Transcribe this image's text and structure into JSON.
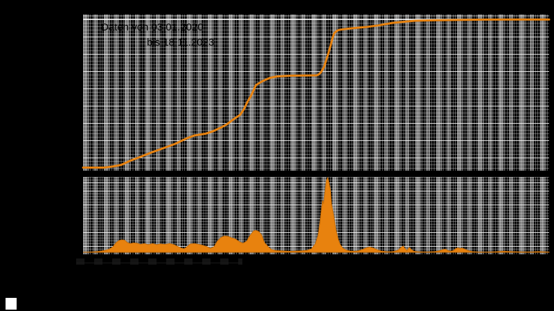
{
  "annotation": {
    "line1": "Daten von 03.01.2020",
    "line2": "bis 18.11.2023"
  },
  "colors": {
    "accent_orange": "#e8820e",
    "accent_orange_dark": "#c96e06",
    "plot_background": "#000000",
    "grid_bright": "#ffffff",
    "grid_gray": "#a5a5a5",
    "annotation_text": "#000000",
    "marker_square": "#ffffff"
  },
  "chart_data": [
    {
      "type": "line",
      "name": "cumulative-total",
      "title": "",
      "x_range": [
        "03.01.2020",
        "18.11.2023"
      ],
      "xlabel": "",
      "ylabel": "",
      "y_normalized": true,
      "ylim": [
        0,
        1
      ],
      "grid": true,
      "legend": "none",
      "annotations": [
        "Daten von 03.01.2020",
        "bis 18.11.2023"
      ],
      "points": [
        [
          0.0,
          0.034
        ],
        [
          0.045,
          0.034
        ],
        [
          0.064,
          0.041
        ],
        [
          0.082,
          0.052
        ],
        [
          0.1,
          0.077
        ],
        [
          0.119,
          0.099
        ],
        [
          0.149,
          0.135
        ],
        [
          0.174,
          0.162
        ],
        [
          0.198,
          0.189
        ],
        [
          0.22,
          0.221
        ],
        [
          0.238,
          0.243
        ],
        [
          0.263,
          0.255
        ],
        [
          0.278,
          0.27
        ],
        [
          0.297,
          0.297
        ],
        [
          0.308,
          0.315
        ],
        [
          0.322,
          0.347
        ],
        [
          0.337,
          0.378
        ],
        [
          0.345,
          0.414
        ],
        [
          0.352,
          0.459
        ],
        [
          0.36,
          0.5
        ],
        [
          0.371,
          0.572
        ],
        [
          0.386,
          0.599
        ],
        [
          0.401,
          0.619
        ],
        [
          0.416,
          0.628
        ],
        [
          0.446,
          0.633
        ],
        [
          0.476,
          0.634
        ],
        [
          0.501,
          0.635
        ],
        [
          0.505,
          0.64
        ],
        [
          0.51,
          0.653
        ],
        [
          0.517,
          0.689
        ],
        [
          0.525,
          0.766
        ],
        [
          0.531,
          0.829
        ],
        [
          0.535,
          0.878
        ],
        [
          0.539,
          0.91
        ],
        [
          0.545,
          0.926
        ],
        [
          0.55,
          0.932
        ],
        [
          0.565,
          0.938
        ],
        [
          0.587,
          0.945
        ],
        [
          0.605,
          0.949
        ],
        [
          0.634,
          0.961
        ],
        [
          0.664,
          0.977
        ],
        [
          0.694,
          0.986
        ],
        [
          0.713,
          0.991
        ],
        [
          0.758,
          0.994
        ],
        [
          0.802,
          0.996
        ],
        [
          0.862,
          0.998
        ],
        [
          0.936,
          0.999
        ],
        [
          1.0,
          0.999
        ]
      ]
    },
    {
      "type": "area",
      "name": "daily-values",
      "title": "",
      "x_range": [
        "03.01.2020",
        "18.11.2023"
      ],
      "xlabel": "",
      "ylabel": "",
      "y_normalized": true,
      "ylim": [
        0,
        1
      ],
      "grid": true,
      "legend": "none",
      "points": [
        [
          0.0,
          0.0
        ],
        [
          0.012,
          0.003
        ],
        [
          0.024,
          0.007
        ],
        [
          0.037,
          0.014
        ],
        [
          0.049,
          0.028
        ],
        [
          0.056,
          0.042
        ],
        [
          0.064,
          0.074
        ],
        [
          0.071,
          0.13
        ],
        [
          0.077,
          0.157
        ],
        [
          0.083,
          0.167
        ],
        [
          0.089,
          0.162
        ],
        [
          0.095,
          0.13
        ],
        [
          0.101,
          0.116
        ],
        [
          0.108,
          0.125
        ],
        [
          0.116,
          0.12
        ],
        [
          0.123,
          0.106
        ],
        [
          0.131,
          0.116
        ],
        [
          0.14,
          0.102
        ],
        [
          0.149,
          0.116
        ],
        [
          0.158,
          0.102
        ],
        [
          0.166,
          0.111
        ],
        [
          0.175,
          0.106
        ],
        [
          0.186,
          0.116
        ],
        [
          0.195,
          0.102
        ],
        [
          0.204,
          0.074
        ],
        [
          0.211,
          0.056
        ],
        [
          0.217,
          0.046
        ],
        [
          0.223,
          0.074
        ],
        [
          0.23,
          0.111
        ],
        [
          0.239,
          0.116
        ],
        [
          0.248,
          0.106
        ],
        [
          0.257,
          0.093
        ],
        [
          0.266,
          0.074
        ],
        [
          0.273,
          0.051
        ],
        [
          0.281,
          0.074
        ],
        [
          0.288,
          0.148
        ],
        [
          0.296,
          0.199
        ],
        [
          0.303,
          0.218
        ],
        [
          0.311,
          0.213
        ],
        [
          0.318,
          0.194
        ],
        [
          0.327,
          0.176
        ],
        [
          0.336,
          0.139
        ],
        [
          0.343,
          0.12
        ],
        [
          0.351,
          0.148
        ],
        [
          0.358,
          0.222
        ],
        [
          0.366,
          0.287
        ],
        [
          0.371,
          0.292
        ],
        [
          0.377,
          0.278
        ],
        [
          0.383,
          0.231
        ],
        [
          0.389,
          0.13
        ],
        [
          0.397,
          0.074
        ],
        [
          0.404,
          0.037
        ],
        [
          0.413,
          0.023
        ],
        [
          0.423,
          0.019
        ],
        [
          0.434,
          0.017
        ],
        [
          0.446,
          0.014
        ],
        [
          0.458,
          0.017
        ],
        [
          0.47,
          0.019
        ],
        [
          0.481,
          0.026
        ],
        [
          0.49,
          0.046
        ],
        [
          0.498,
          0.111
        ],
        [
          0.504,
          0.222
        ],
        [
          0.508,
          0.389
        ],
        [
          0.511,
          0.556
        ],
        [
          0.514,
          0.694
        ],
        [
          0.516,
          0.648
        ],
        [
          0.519,
          0.815
        ],
        [
          0.522,
          0.963
        ],
        [
          0.525,
          1.0
        ],
        [
          0.528,
          0.926
        ],
        [
          0.531,
          0.815
        ],
        [
          0.533,
          0.648
        ],
        [
          0.538,
          0.481
        ],
        [
          0.542,
          0.315
        ],
        [
          0.547,
          0.185
        ],
        [
          0.551,
          0.111
        ],
        [
          0.557,
          0.056
        ],
        [
          0.565,
          0.028
        ],
        [
          0.574,
          0.017
        ],
        [
          0.583,
          0.014
        ],
        [
          0.591,
          0.019
        ],
        [
          0.6,
          0.037
        ],
        [
          0.608,
          0.06
        ],
        [
          0.615,
          0.069
        ],
        [
          0.623,
          0.056
        ],
        [
          0.631,
          0.032
        ],
        [
          0.64,
          0.017
        ],
        [
          0.651,
          0.009
        ],
        [
          0.661,
          0.007
        ],
        [
          0.669,
          0.014
        ],
        [
          0.676,
          0.028
        ],
        [
          0.682,
          0.065
        ],
        [
          0.687,
          0.083
        ],
        [
          0.691,
          0.046
        ],
        [
          0.695,
          0.023
        ],
        [
          0.7,
          0.065
        ],
        [
          0.704,
          0.037
        ],
        [
          0.71,
          0.014
        ],
        [
          0.719,
          0.007
        ],
        [
          0.731,
          0.005
        ],
        [
          0.743,
          0.006
        ],
        [
          0.755,
          0.009
        ],
        [
          0.764,
          0.019
        ],
        [
          0.771,
          0.032
        ],
        [
          0.777,
          0.042
        ],
        [
          0.783,
          0.023
        ],
        [
          0.789,
          0.014
        ],
        [
          0.795,
          0.023
        ],
        [
          0.799,
          0.046
        ],
        [
          0.804,
          0.06
        ],
        [
          0.808,
          0.051
        ],
        [
          0.813,
          0.056
        ],
        [
          0.817,
          0.046
        ],
        [
          0.822,
          0.032
        ],
        [
          0.828,
          0.019
        ],
        [
          0.835,
          0.009
        ],
        [
          0.847,
          0.005
        ],
        [
          0.862,
          0.003
        ],
        [
          0.874,
          0.005
        ],
        [
          0.884,
          0.007
        ],
        [
          0.894,
          0.011
        ],
        [
          0.903,
          0.014
        ],
        [
          0.912,
          0.012
        ],
        [
          0.921,
          0.009
        ],
        [
          0.932,
          0.007
        ],
        [
          0.942,
          0.005
        ],
        [
          0.954,
          0.005
        ],
        [
          0.966,
          0.006
        ],
        [
          0.976,
          0.009
        ],
        [
          0.985,
          0.007
        ],
        [
          0.994,
          0.005
        ],
        [
          1.0,
          0.003
        ]
      ]
    }
  ]
}
